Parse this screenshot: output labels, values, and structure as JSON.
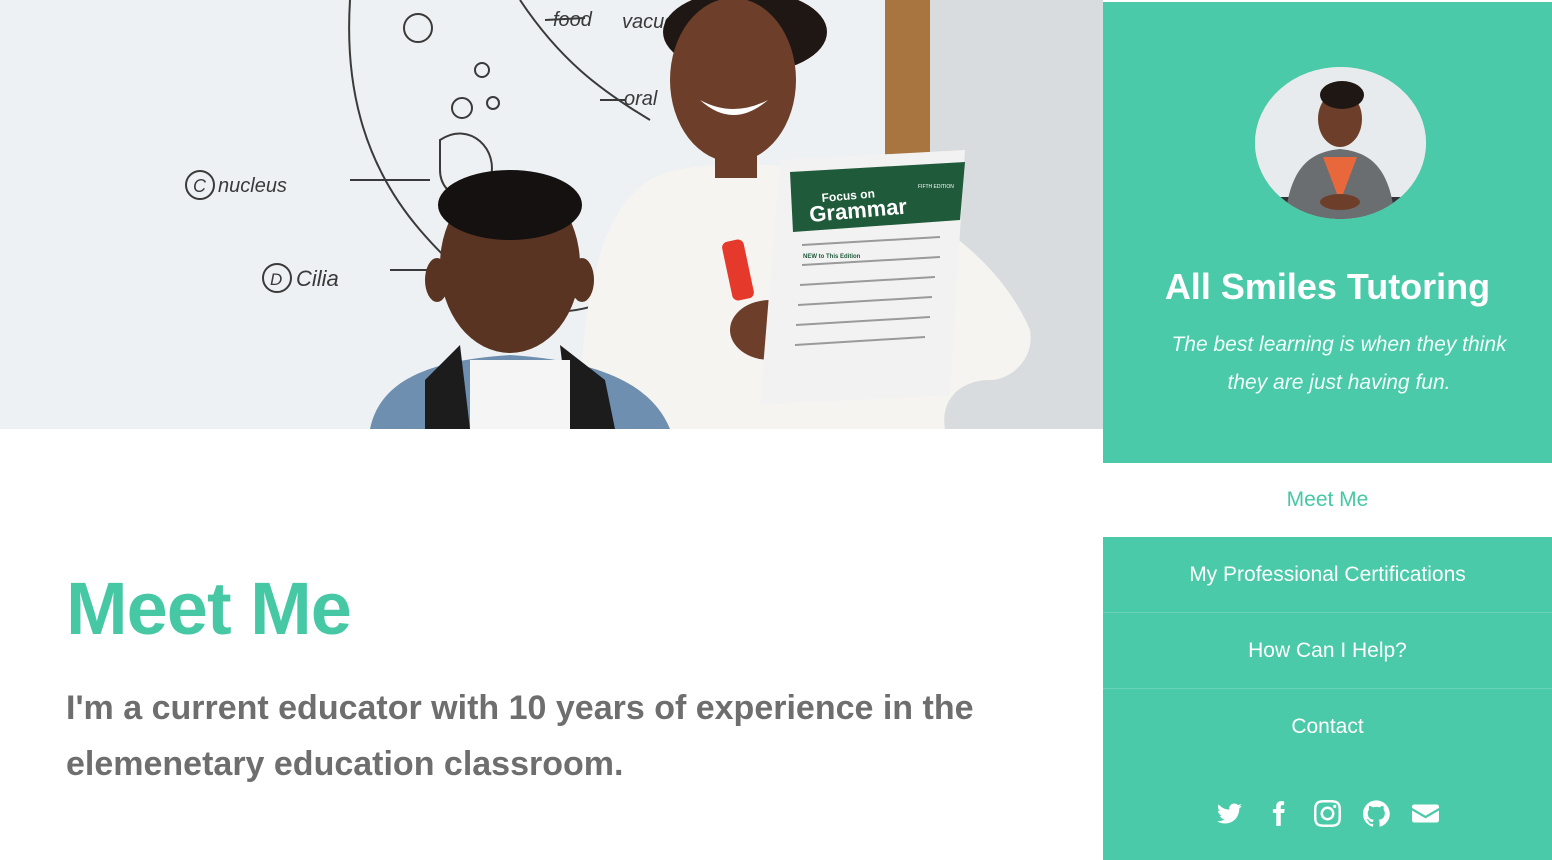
{
  "hero": {
    "board_words": [
      "food",
      "vacuo",
      "oral",
      "nucleus",
      "Cilia"
    ],
    "board_letters": [
      "C",
      "D"
    ],
    "book": {
      "title_top": "Focus on",
      "title_main": "Grammar",
      "edition": "FIFTH EDITION",
      "new_label": "NEW to This Edition"
    }
  },
  "main": {
    "title": "Meet Me",
    "text": "I'm a current educator with 10 years of experience in the elemenetary education classroom."
  },
  "sidebar": {
    "site_title": "All Smiles Tutoring",
    "tagline": "The best learning is when they think they are just having fun.",
    "nav": [
      {
        "label": "Meet Me",
        "active": true
      },
      {
        "label": "My Professional Certifications"
      },
      {
        "label": "How Can I Help?"
      },
      {
        "label": "Contact"
      }
    ],
    "social_icons": [
      "twitter-icon",
      "facebook-icon",
      "instagram-icon",
      "github-icon",
      "envelope-icon"
    ]
  },
  "colors": {
    "accent": "#4acaa8",
    "accent_text": "#47c8a5",
    "body_text": "#6e6e6e",
    "white": "#ffffff"
  }
}
